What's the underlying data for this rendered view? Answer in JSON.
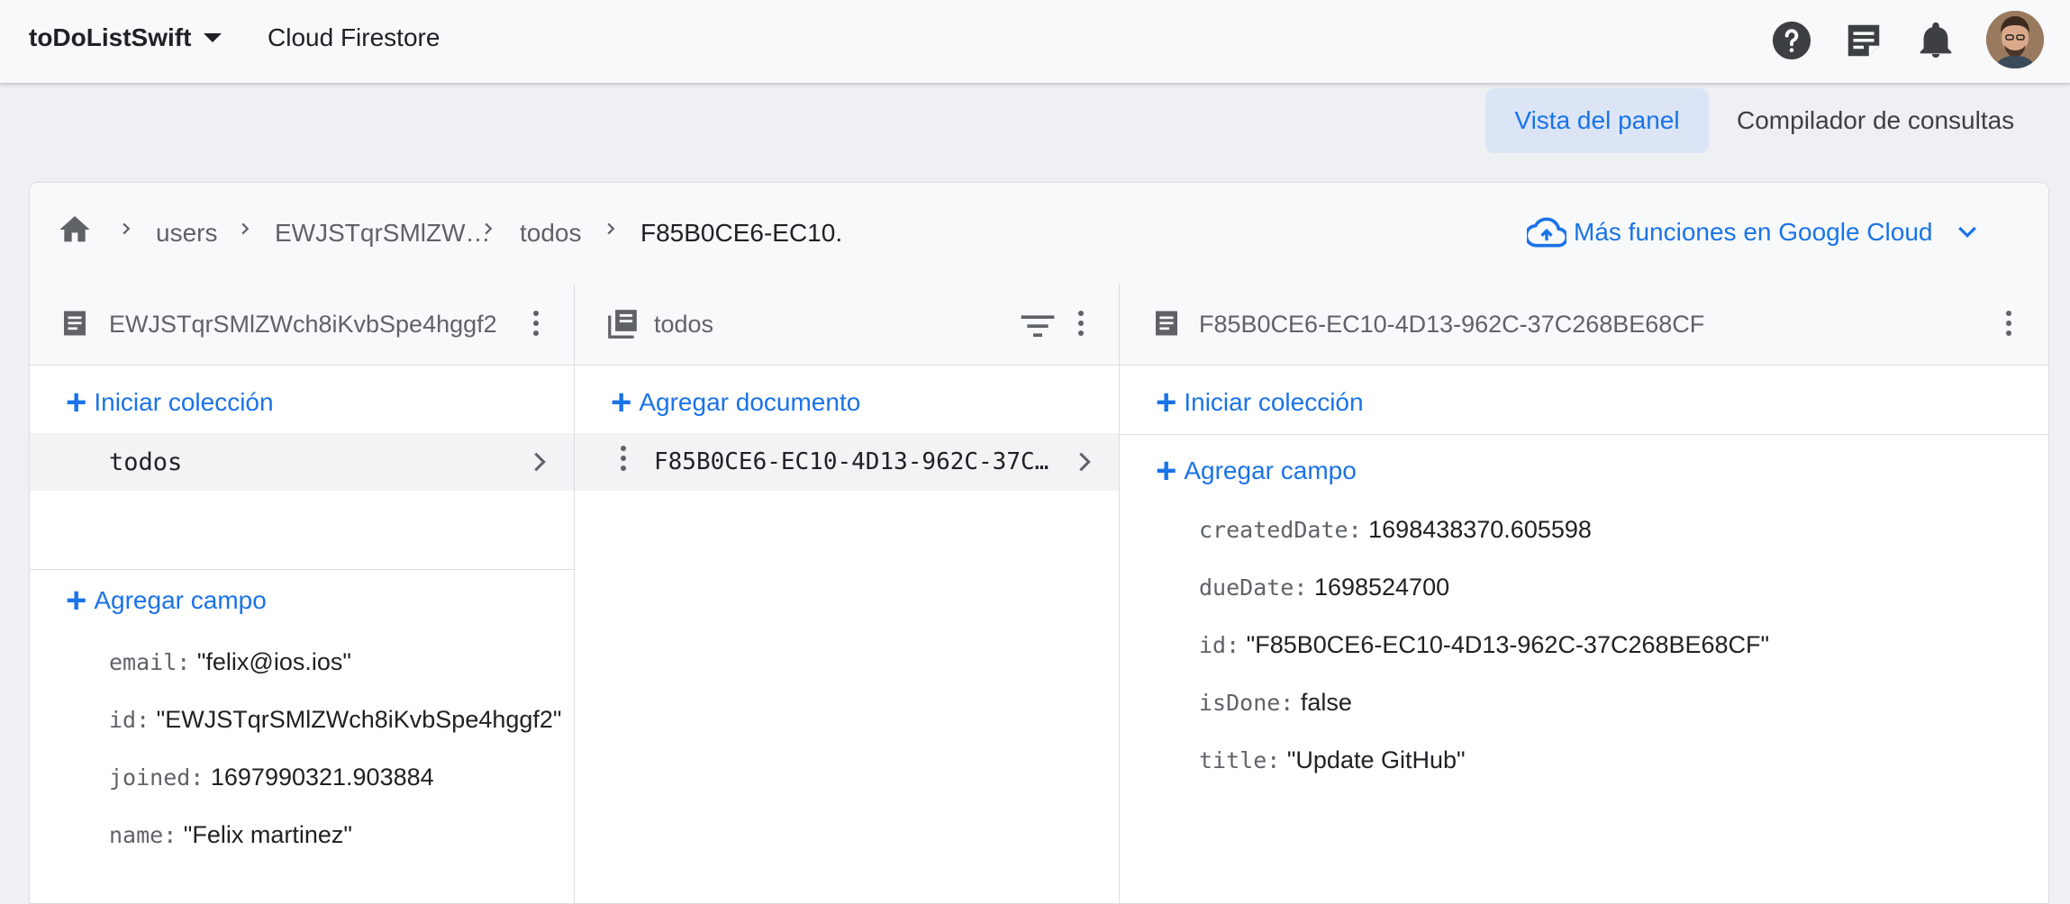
{
  "topbar": {
    "project_name": "toDoListSwift",
    "product_name": "Cloud Firestore"
  },
  "view_tabs": {
    "panel": "Vista del panel",
    "query_builder": "Compilador de consultas"
  },
  "breadcrumb": {
    "items": [
      "users",
      "EWJSTqrSMlZW…",
      "todos",
      "F85B0CE6-EC10."
    ],
    "gcloud_label": "Más funciones en Google Cloud"
  },
  "col1": {
    "title": "EWJSTqrSMlZWch8iKvbSpe4hggf2",
    "start_collection": "Iniciar colección",
    "collections": [
      "todos"
    ],
    "add_field": "Agregar campo",
    "fields": [
      {
        "key": "email:",
        "value": "\"felix@ios.ios\""
      },
      {
        "key": "id:",
        "value": "\"EWJSTqrSMlZWch8iKvbSpe4hggf2\""
      },
      {
        "key": "joined:",
        "value": "1697990321.903884"
      },
      {
        "key": "name:",
        "value": "\"Felix martinez\""
      }
    ]
  },
  "col2": {
    "title": "todos",
    "add_document": "Agregar documento",
    "documents": [
      "F85B0CE6-EC10-4D13-962C-37C…"
    ]
  },
  "col3": {
    "title": "F85B0CE6-EC10-4D13-962C-37C268BE68CF",
    "start_collection": "Iniciar colección",
    "add_field": "Agregar campo",
    "fields": [
      {
        "key": "createdDate:",
        "value": "1698438370.605598"
      },
      {
        "key": "dueDate:",
        "value": "1698524700"
      },
      {
        "key": "id:",
        "value": "\"F85B0CE6-EC10-4D13-962C-37C268BE68CF\""
      },
      {
        "key": "isDone:",
        "value": "false"
      },
      {
        "key": "title:",
        "value": "\"Update GitHub\""
      }
    ]
  },
  "colors": {
    "accent": "#1a73e8",
    "selected_tab_bg": "#dbe5f6",
    "text_secondary": "#5f6368"
  }
}
